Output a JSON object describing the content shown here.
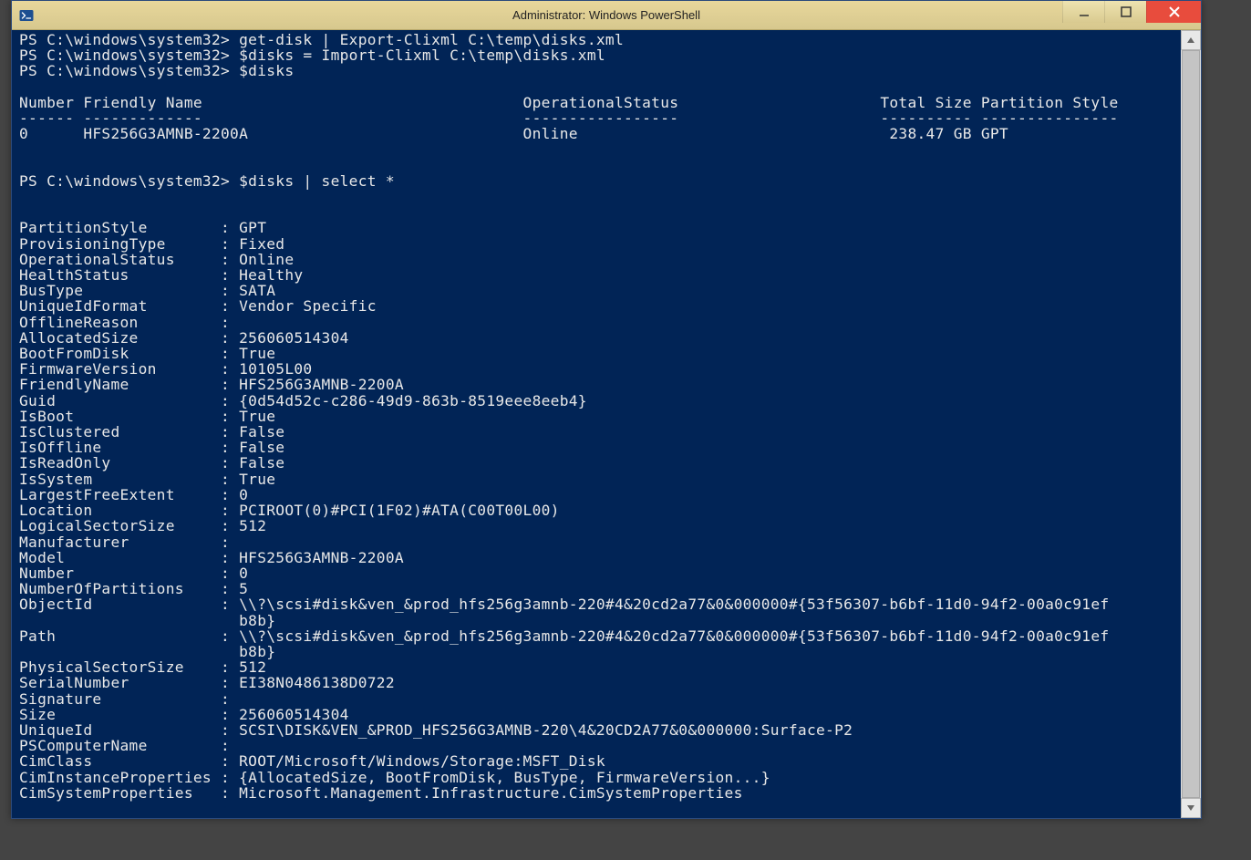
{
  "window": {
    "title": "Administrator: Windows PowerShell"
  },
  "prompts": [
    {
      "prompt": "PS C:\\windows\\system32> ",
      "command": "get-disk | Export-Clixml C:\\temp\\disks.xml"
    },
    {
      "prompt": "PS C:\\windows\\system32> ",
      "command": "$disks = Import-Clixml C:\\temp\\disks.xml"
    },
    {
      "prompt": "PS C:\\windows\\system32> ",
      "command": "$disks"
    }
  ],
  "table": {
    "headers": {
      "number": "Number",
      "friendly": "Friendly Name",
      "opstatus": "OperationalStatus",
      "totalsize": "Total Size",
      "pstyle": "Partition Style"
    },
    "dashes": {
      "number": "------",
      "friendly": "-------------",
      "opstatus": "-----------------",
      "totalsize": "----------",
      "pstyle": "---------------"
    },
    "row": {
      "number": "0",
      "friendly": "HFS256G3AMNB-2200A",
      "opstatus": "Online",
      "totalsize": "238.47 GB",
      "pstyle": "GPT"
    }
  },
  "prompt4": {
    "prompt": "PS C:\\windows\\system32> ",
    "command": "$disks | select *"
  },
  "props": {
    "PartitionStyle": "GPT",
    "ProvisioningType": "Fixed",
    "OperationalStatus": "Online",
    "HealthStatus": "Healthy",
    "BusType": "SATA",
    "UniqueIdFormat": "Vendor Specific",
    "OfflineReason": "",
    "AllocatedSize": "256060514304",
    "BootFromDisk": "True",
    "FirmwareVersion": "10105L00",
    "FriendlyName": "HFS256G3AMNB-2200A",
    "Guid": "{0d54d52c-c286-49d9-863b-8519eee8eeb4}",
    "IsBoot": "True",
    "IsClustered": "False",
    "IsOffline": "False",
    "IsReadOnly": "False",
    "IsSystem": "True",
    "LargestFreeExtent": "0",
    "Location": "PCIROOT(0)#PCI(1F02)#ATA(C00T00L00)",
    "LogicalSectorSize": "512",
    "Manufacturer": "",
    "Model": "HFS256G3AMNB-2200A",
    "Number": "0",
    "NumberOfPartitions": "5",
    "ObjectId_l1": "\\\\?\\scsi#disk&ven_&prod_hfs256g3amnb-220#4&20cd2a77&0&000000#{53f56307-b6bf-11d0-94f2-00a0c91ef",
    "ObjectId_l2": "b8b}",
    "Path_l1": "\\\\?\\scsi#disk&ven_&prod_hfs256g3amnb-220#4&20cd2a77&0&000000#{53f56307-b6bf-11d0-94f2-00a0c91ef",
    "Path_l2": "b8b}",
    "PhysicalSectorSize": "512",
    "SerialNumber": "EI38N0486138D0722",
    "Signature": "",
    "Size": "256060514304",
    "UniqueId": "SCSI\\DISK&VEN_&PROD_HFS256G3AMNB-220\\4&20CD2A77&0&000000:Surface-P2",
    "PSComputerName": "",
    "CimClass": "ROOT/Microsoft/Windows/Storage:MSFT_Disk",
    "CimInstanceProperties": "{AllocatedSize, BootFromDisk, BusType, FirmwareVersion...}",
    "CimSystemProperties": "Microsoft.Management.Infrastructure.CimSystemProperties"
  },
  "keys": {
    "PartitionStyle": "PartitionStyle",
    "ProvisioningType": "ProvisioningType",
    "OperationalStatus": "OperationalStatus",
    "HealthStatus": "HealthStatus",
    "BusType": "BusType",
    "UniqueIdFormat": "UniqueIdFormat",
    "OfflineReason": "OfflineReason",
    "AllocatedSize": "AllocatedSize",
    "BootFromDisk": "BootFromDisk",
    "FirmwareVersion": "FirmwareVersion",
    "FriendlyName": "FriendlyName",
    "Guid": "Guid",
    "IsBoot": "IsBoot",
    "IsClustered": "IsClustered",
    "IsOffline": "IsOffline",
    "IsReadOnly": "IsReadOnly",
    "IsSystem": "IsSystem",
    "LargestFreeExtent": "LargestFreeExtent",
    "Location": "Location",
    "LogicalSectorSize": "LogicalSectorSize",
    "Manufacturer": "Manufacturer",
    "Model": "Model",
    "Number": "Number",
    "NumberOfPartitions": "NumberOfPartitions",
    "ObjectId": "ObjectId",
    "Path": "Path",
    "PhysicalSectorSize": "PhysicalSectorSize",
    "SerialNumber": "SerialNumber",
    "Signature": "Signature",
    "Size": "Size",
    "UniqueId": "UniqueId",
    "PSComputerName": "PSComputerName",
    "CimClass": "CimClass",
    "CimInstanceProperties": "CimInstanceProperties",
    "CimSystemProperties": "CimSystemProperties"
  }
}
